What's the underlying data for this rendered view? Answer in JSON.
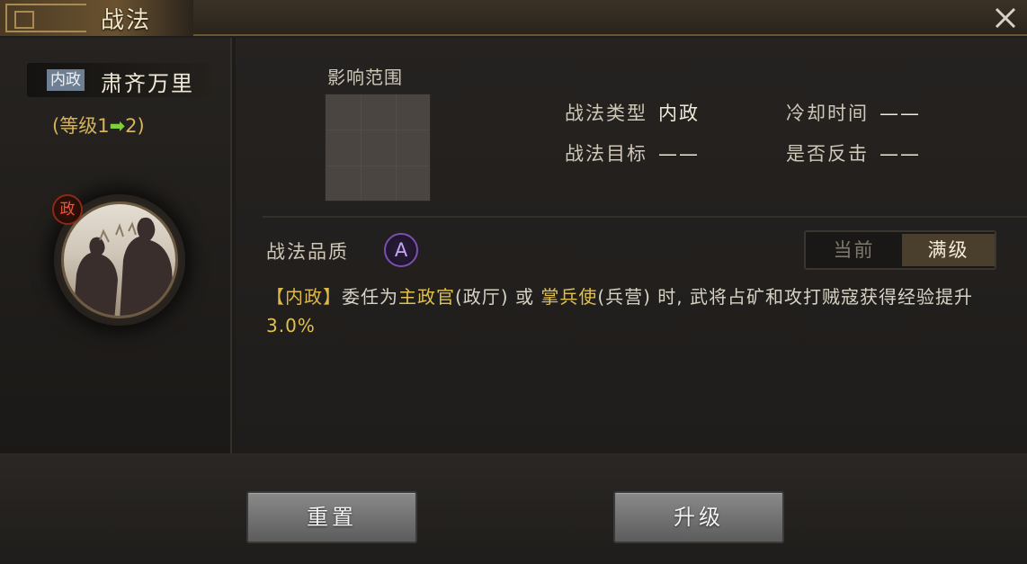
{
  "header": {
    "title": "战法",
    "close_icon": "close-icon"
  },
  "skill": {
    "type_badge": "内政",
    "name": "肃齐万里",
    "level_prefix": "(等级1",
    "level_suffix": "2)",
    "category_badge": "政"
  },
  "range": {
    "label": "影响范围"
  },
  "info": {
    "type_label": "战法类型",
    "type_value": "内政",
    "cooldown_label": "冷却时间",
    "cooldown_value": "——",
    "target_label": "战法目标",
    "target_value": "——",
    "counter_label": "是否反击",
    "counter_value": "——"
  },
  "quality": {
    "label": "战法品质",
    "grade": "A"
  },
  "toggle": {
    "current_label": "当前",
    "max_label": "满级",
    "selected": "max"
  },
  "description": {
    "tag": "【内政】",
    "t1": "委任为",
    "h1": "主政官",
    "t2": "(政厅) 或 ",
    "h2": "掌兵使",
    "t3": "(兵营) 时, 武将占矿和攻打贼寇获得经验提升",
    "value": "3.0%"
  },
  "buttons": {
    "reset": "重置",
    "upgrade": "升级"
  },
  "colors": {
    "highlight": "#e0c050",
    "level_arrow": "#7fcf3a",
    "quality_purple": "#7b4fb0"
  }
}
